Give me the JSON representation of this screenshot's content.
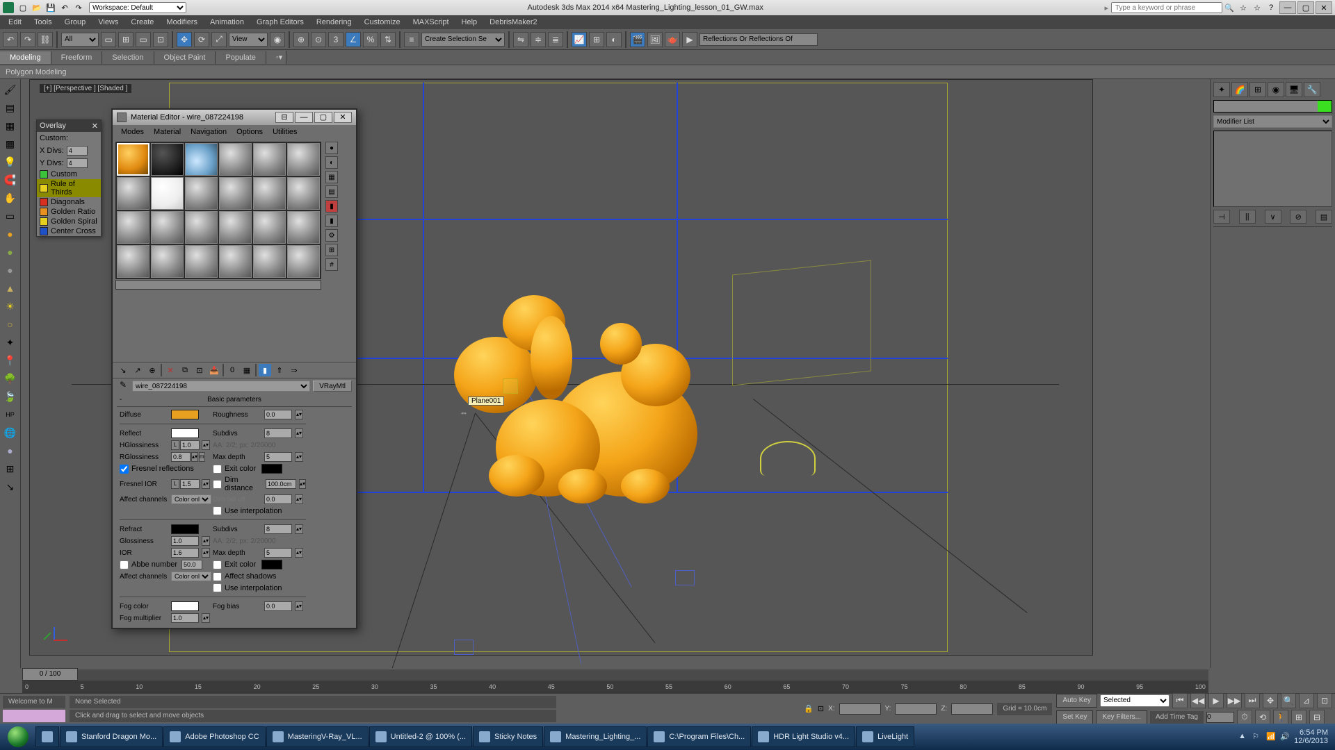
{
  "titlebar": {
    "workspace": "Workspace: Default",
    "title": "Autodesk 3ds Max 2014 x64   Mastering_Lighting_lesson_01_GW.max",
    "search_placeholder": "Type a keyword or phrase"
  },
  "menus": [
    "Edit",
    "Tools",
    "Group",
    "Views",
    "Create",
    "Modifiers",
    "Animation",
    "Graph Editors",
    "Rendering",
    "Customize",
    "MAXScript",
    "Help",
    "DebrisMaker2"
  ],
  "toolbar": {
    "named_sel": "All",
    "view": "View",
    "create_sel": "Create Selection Se",
    "reflections": "Reflections Or Reflections Of"
  },
  "ribbon": {
    "tabs": [
      "Modeling",
      "Freeform",
      "Selection",
      "Object Paint",
      "Populate"
    ],
    "panel": "Polygon Modeling"
  },
  "viewport": {
    "label": "[+] [Perspective ] [Shaded ]",
    "obj_label": "Plane001"
  },
  "overlay": {
    "title": "Overlay",
    "custom": "Custom:",
    "xdivs_lbl": "X Divs:",
    "xdivs_val": "4",
    "ydivs_lbl": "Y Divs:",
    "ydivs_val": "4",
    "items": [
      {
        "label": "Custom",
        "color": "#3ac23a"
      },
      {
        "label": "Rule of Thirds",
        "color": "#e8d020"
      },
      {
        "label": "Diagonals",
        "color": "#d83020"
      },
      {
        "label": "Golden Ratio",
        "color": "#e89020"
      },
      {
        "label": "Golden Spiral",
        "color": "#e8d020"
      },
      {
        "label": "Center Cross",
        "color": "#2050c8"
      }
    ]
  },
  "right_panel": {
    "modifier_list": "Modifier List"
  },
  "timeline": {
    "slider": "0 / 100",
    "ticks": [
      "0",
      "5",
      "10",
      "15",
      "20",
      "25",
      "30",
      "35",
      "40",
      "45",
      "50",
      "55",
      "60",
      "65",
      "70",
      "75",
      "80",
      "85",
      "90",
      "95",
      "100"
    ]
  },
  "status": {
    "script": "Welcome to M",
    "selection": "None Selected",
    "prompt": "Click and drag to select and move objects",
    "x": "X:",
    "y": "Y:",
    "z": "Z:",
    "grid": "Grid = 10.0cm",
    "autokey": "Auto Key",
    "setkey": "Set Key",
    "selected": "Selected",
    "addtag": "Add Time Tag",
    "keyfilters": "Key Filters..."
  },
  "material_editor": {
    "title": "Material Editor - wire_087224198",
    "menus": [
      "Modes",
      "Material",
      "Navigation",
      "Options",
      "Utilities"
    ],
    "mat_name": "wire_087224198",
    "mat_type": "VRayMtl",
    "rollout": "Basic parameters",
    "params": {
      "diffuse": "Diffuse",
      "diffuse_color": "#e8a020",
      "roughness": "Roughness",
      "roughness_v": "0.0",
      "reflect": "Reflect",
      "reflect_color": "#ffffff",
      "subdivs": "Subdivs",
      "subdivs_v": "8",
      "hgloss": "HGlossiness",
      "hgloss_v": "1.0",
      "hgloss_l": "L",
      "aa": "AA: 2/2; px: 2/20000",
      "rgloss": "RGlossiness",
      "rgloss_v": "0.8",
      "rgloss_m": "m",
      "maxdepth": "Max depth",
      "maxdepth_v": "5",
      "fresnel": "Fresnel reflections",
      "exitcolor": "Exit color",
      "fresnelior": "Fresnel IOR",
      "fresnelior_l": "L",
      "fresnelior_v": "1.5",
      "dimdist": "Dim distance",
      "dimdist_v": "100.0cm",
      "affectch": "Affect channels",
      "affectch_v": "Color only",
      "dimfall": "Dim fall off",
      "dimfall_v": "0.0",
      "useinterp": "Use interpolation",
      "refract": "Refract",
      "refract_color": "#000000",
      "refr_subdivs": "Subdivs",
      "refr_subdivs_v": "8",
      "glossiness": "Glossiness",
      "glossiness_v": "1.0",
      "refr_aa": "AA: 2/2; px: 2/20000",
      "ior": "IOR",
      "ior_v": "1.6",
      "refr_maxdepth": "Max depth",
      "refr_maxdepth_v": "5",
      "abbe": "Abbe number",
      "abbe_v": "50.0",
      "refr_exit": "Exit color",
      "refr_affect": "Affect channels",
      "refr_affect_v": "Color only",
      "affshadow": "Affect shadows",
      "refr_interp": "Use interpolation",
      "fogcolor": "Fog color",
      "fogcolor_sw": "#ffffff",
      "fogbias": "Fog bias",
      "fogbias_v": "0.0",
      "fogmult": "Fog multiplier",
      "fogmult_v": "1.0"
    }
  },
  "taskbar": {
    "items": [
      "Stanford Dragon Mo...",
      "Adobe Photoshop CC",
      "MasteringV-Ray_VL...",
      "Untitled-2 @ 100% (...",
      "Sticky Notes",
      "Mastering_Lighting_...",
      "C:\\Program Files\\Ch...",
      "HDR Light Studio v4...",
      "LiveLight"
    ],
    "time": "6:54 PM",
    "date": "12/6/2013"
  }
}
